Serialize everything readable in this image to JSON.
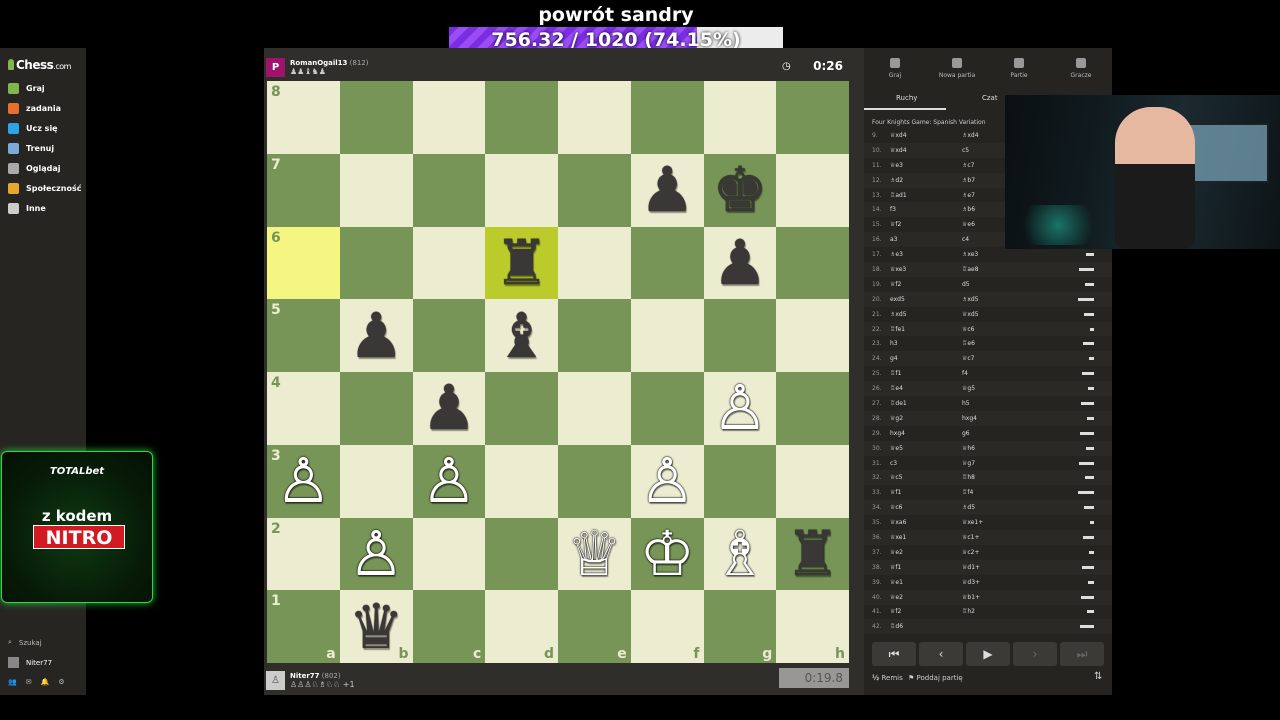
{
  "overlay": {
    "title": "powrót sandry",
    "progress_text": "756.32 / 1020 (74.15%)",
    "progress_fraction": 0.7415
  },
  "sidebar": {
    "logo_main": "Chess",
    "logo_suffix": ".com",
    "items": [
      {
        "label": "Graj",
        "color": "#81b64c"
      },
      {
        "label": "zadania",
        "color": "#e8702a"
      },
      {
        "label": "Ucz się",
        "color": "#2aa5e8"
      },
      {
        "label": "Trenuj",
        "color": "#7ba9d9"
      },
      {
        "label": "Oglądaj",
        "color": "#aaaaaa"
      },
      {
        "label": "Społeczność",
        "color": "#e8a72a"
      },
      {
        "label": "Inne",
        "color": "#cccccc"
      }
    ],
    "search": "Szukaj",
    "user": "Niter77"
  },
  "ad": {
    "brand": "TOTALbet",
    "line1": "z kodem",
    "line2": "NITRO"
  },
  "top_player": {
    "avatar_letter": "P",
    "name": "RomanOgail13",
    "rating": "(812)",
    "captured": "♟♟♝♞♟"
  },
  "top_clock": "0:26",
  "bottom_player": {
    "name": "Niter77",
    "rating": "(802)",
    "captured": "♙♙♙♘♗♘♘ +1"
  },
  "bottom_clock": "0:19.8",
  "board": {
    "ranks": [
      "8",
      "7",
      "6",
      "5",
      "4",
      "3",
      "2",
      "1"
    ],
    "files": [
      "a",
      "b",
      "c",
      "d",
      "e",
      "f",
      "g",
      "h"
    ],
    "highlight": [
      "a6",
      "d6"
    ],
    "pieces": {
      "f7": "♟",
      "g7": "♚",
      "d6": "♜",
      "g6": "♟",
      "b5": "♟",
      "d5": "♝",
      "c4": "♟",
      "g4": "♙",
      "a3": "♙",
      "c3": "♙",
      "f3": "♙",
      "b2": "♙",
      "e2": "♕",
      "f2": "♔",
      "g2": "♗",
      "h2": "♜",
      "b1": "♛"
    },
    "white_pieces": [
      "g4",
      "a3",
      "c3",
      "f3",
      "b2",
      "e2",
      "f2",
      "g2"
    ],
    "black_pieces": [
      "f7",
      "g7",
      "d6",
      "g6",
      "b5",
      "d5",
      "c4",
      "h2",
      "b1"
    ]
  },
  "panel": {
    "tabs": [
      "Graj",
      "Nowa partia",
      "Partie",
      "Gracze"
    ],
    "subtabs": [
      "Ruchy",
      "Czat"
    ],
    "opening": "Four Knights Game: Spanish Variation",
    "moves": [
      {
        "n": "9.",
        "w": "♕xd4",
        "b": "♗xd4"
      },
      {
        "n": "10.",
        "w": "♕xd4",
        "b": "c5"
      },
      {
        "n": "11.",
        "w": "♕e3",
        "b": "♗c7"
      },
      {
        "n": "12.",
        "w": "♗d2",
        "b": "♗b7"
      },
      {
        "n": "13.",
        "w": "♖ad1",
        "b": "♗e7"
      },
      {
        "n": "14.",
        "w": "f3",
        "b": "♗b6"
      },
      {
        "n": "15.",
        "w": "♕f2",
        "b": "♕e6"
      },
      {
        "n": "16.",
        "w": "a3",
        "b": "c4"
      },
      {
        "n": "17.",
        "w": "♗e3",
        "b": "♗xe3"
      },
      {
        "n": "18.",
        "w": "♕xe3",
        "b": "♖ae8"
      },
      {
        "n": "19.",
        "w": "♕f2",
        "b": "d5"
      },
      {
        "n": "20.",
        "w": "exd5",
        "b": "♗xd5"
      },
      {
        "n": "21.",
        "w": "♗xd5",
        "b": "♕xd5"
      },
      {
        "n": "22.",
        "w": "♖fe1",
        "b": "♕c6"
      },
      {
        "n": "23.",
        "w": "h3",
        "b": "♖e6"
      },
      {
        "n": "24.",
        "w": "g4",
        "b": "♕c7"
      },
      {
        "n": "25.",
        "w": "♖f1",
        "b": "f4"
      },
      {
        "n": "26.",
        "w": "♖e4",
        "b": "♕g5"
      },
      {
        "n": "27.",
        "w": "♖de1",
        "b": "h5"
      },
      {
        "n": "28.",
        "w": "♕g2",
        "b": "hxg4"
      },
      {
        "n": "29.",
        "w": "hxg4",
        "b": "g6"
      },
      {
        "n": "30.",
        "w": "♕e5",
        "b": "♕h6"
      },
      {
        "n": "31.",
        "w": "c3",
        "b": "♕g7"
      },
      {
        "n": "32.",
        "w": "♕c5",
        "b": "♖h8"
      },
      {
        "n": "33.",
        "w": "♕f1",
        "b": "♖f4"
      },
      {
        "n": "34.",
        "w": "♕c6",
        "b": "♗d5"
      },
      {
        "n": "35.",
        "w": "♕xa6",
        "b": "♕xe1+"
      },
      {
        "n": "36.",
        "w": "♕xe1",
        "b": "♕c1+"
      },
      {
        "n": "37.",
        "w": "♕e2",
        "b": "♕c2+"
      },
      {
        "n": "38.",
        "w": "♕f1",
        "b": "♕d1+"
      },
      {
        "n": "39.",
        "w": "♕e1",
        "b": "♕d3+"
      },
      {
        "n": "40.",
        "w": "♕e2",
        "b": "♕b1+"
      },
      {
        "n": "41.",
        "w": "♕f2",
        "b": "♖h2"
      },
      {
        "n": "42.",
        "w": "♖d6",
        "b": ""
      }
    ],
    "draw": "Remis",
    "resign": "Poddaj partię"
  }
}
